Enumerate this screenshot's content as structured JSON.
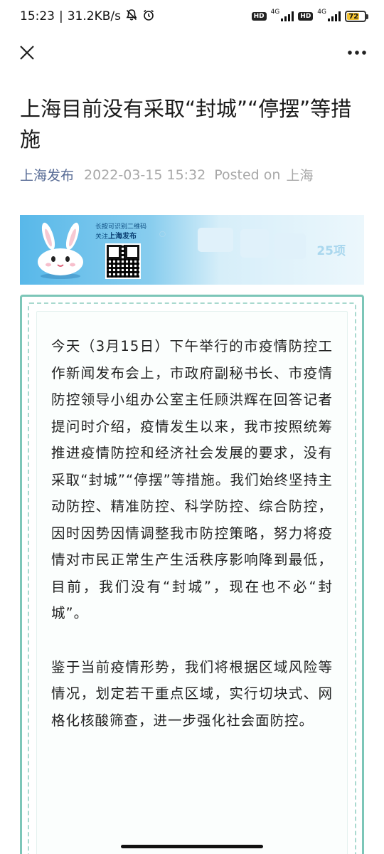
{
  "status_bar": {
    "time": "15:23",
    "speed": "31.2KB/s",
    "hd1": "HD",
    "net1": "4G",
    "hd2": "HD",
    "net2": "4G",
    "battery": "72"
  },
  "nav": {
    "close_icon": "close-icon",
    "more_icon": "more-icon"
  },
  "article": {
    "title": "上海目前没有采取“封城”“停摆”等措施",
    "account": "上海发布",
    "datetime": "2022-03-15 15:32",
    "posted_on": "Posted on",
    "location": "上海",
    "banner": {
      "line1": "长按可识别二维码",
      "line2_prefix": "关注",
      "line2_name": "上海发布",
      "badge": "25项"
    },
    "paragraphs": [
      "今天（3月15日）下午举行的市疫情防控工作新闻发布会上，市政府副秘书长、市疫情防控领导小组办公室主任顾洪辉在回答记者提问时介绍，疫情发生以来，我市按照统筹推进疫情防控和经济社会发展的要求，没有采取“封城”“停摆”等措施。我们始终坚持主动防控、精准防控、科学防控、综合防控，因时因势因情调整我市防控策略，努力将疫情对市民正常生产生活秩序影响降到最低，目前，我们没有“封城”，现在也不必“封城”。",
      "鉴于当前疫情形势，我们将根据区域风险等情况，划定若干重点区域，实行切块式、网格化核酸筛查，进一步强化社会面防控。"
    ]
  }
}
